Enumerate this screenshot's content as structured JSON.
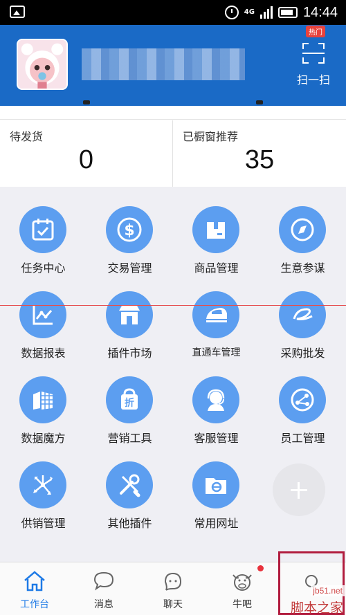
{
  "status_bar": {
    "time": "14:44",
    "network": "4G"
  },
  "header": {
    "scan_label": "扫一扫"
  },
  "stats": [
    {
      "label": "待发货",
      "value": "0"
    },
    {
      "label": "已橱窗推荐",
      "value": "35"
    }
  ],
  "grid": [
    {
      "label": "任务中心",
      "icon": "calendar-check-icon"
    },
    {
      "label": "交易管理",
      "icon": "dollar-coin-icon"
    },
    {
      "label": "商品管理",
      "icon": "package-box-icon"
    },
    {
      "label": "生意参谋",
      "icon": "compass-icon",
      "badge": "热门"
    },
    {
      "label": "数据报表",
      "icon": "line-chart-icon"
    },
    {
      "label": "插件市场",
      "icon": "storefront-icon"
    },
    {
      "label": "直通车管理",
      "icon": "train-icon"
    },
    {
      "label": "采购批发",
      "icon": "alibaba-logo-icon"
    },
    {
      "label": "数据魔方",
      "icon": "cube-icon"
    },
    {
      "label": "营销工具",
      "icon": "discount-bag-icon"
    },
    {
      "label": "客服管理",
      "icon": "headset-agent-icon"
    },
    {
      "label": "员工管理",
      "icon": "share-nodes-icon"
    },
    {
      "label": "供销管理",
      "icon": "arrows-out-icon"
    },
    {
      "label": "其他插件",
      "icon": "wrench-screwdriver-icon"
    },
    {
      "label": "常用网址",
      "icon": "folder-browser-icon"
    }
  ],
  "tabs": [
    {
      "label": "工作台",
      "icon": "home-icon",
      "active": true
    },
    {
      "label": "消息",
      "icon": "chat-bubble-icon"
    },
    {
      "label": "聊天",
      "icon": "chat-smile-icon"
    },
    {
      "label": "牛吧",
      "icon": "cow-face-icon"
    }
  ],
  "watermark": {
    "site": "jb51.net",
    "name": "脚本之家"
  },
  "colors": {
    "header": "#1a6ac6",
    "icon_circle": "#5c9ef0",
    "active_tab": "#1e7ae6",
    "badge": "#e9423c"
  }
}
